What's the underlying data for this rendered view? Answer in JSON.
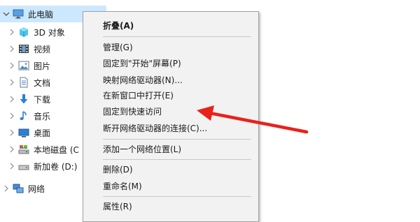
{
  "tree": {
    "items": [
      {
        "label": "此电脑",
        "icon": "computer-icon"
      },
      {
        "label": "3D 对象",
        "icon": "3d-objects-icon"
      },
      {
        "label": "视频",
        "icon": "video-icon"
      },
      {
        "label": "图片",
        "icon": "pictures-icon"
      },
      {
        "label": "文档",
        "icon": "documents-icon"
      },
      {
        "label": "下载",
        "icon": "download-icon"
      },
      {
        "label": "音乐",
        "icon": "music-icon"
      },
      {
        "label": "桌面",
        "icon": "desktop-icon"
      },
      {
        "label": "本地磁盘 (C",
        "icon": "local-disk-icon"
      },
      {
        "label": "新加卷 (D:)",
        "icon": "drive-icon"
      },
      {
        "label": "网络",
        "icon": "network-icon"
      }
    ]
  },
  "context_menu": {
    "items": [
      {
        "label": "折叠(A)"
      },
      {
        "label": "管理(G)"
      },
      {
        "label": "固定到\"开始\"屏幕(P)"
      },
      {
        "label": "映射网络驱动器(N)..."
      },
      {
        "label": "在新窗口中打开(E)"
      },
      {
        "label": "固定到快速访问"
      },
      {
        "label": "断开网络驱动器的连接(C)..."
      },
      {
        "label": "添加一个网络位置(L)"
      },
      {
        "label": "删除(D)"
      },
      {
        "label": "重命名(M)"
      },
      {
        "label": "属性(R)"
      }
    ]
  },
  "colors": {
    "selection": "#cce8ff",
    "menu_bg": "#f2f2f2",
    "arrow": "#e8221b"
  }
}
